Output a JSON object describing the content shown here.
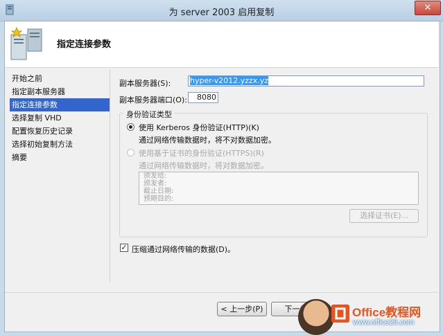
{
  "window": {
    "title": "为 server 2003 启用复制",
    "close_glyph": "✕"
  },
  "header": {
    "title": "指定连接参数"
  },
  "nav": {
    "items": [
      {
        "label": "开始之前",
        "selected": false
      },
      {
        "label": "指定副本服务器",
        "selected": false
      },
      {
        "label": "指定连接参数",
        "selected": true
      },
      {
        "label": "选择复制 VHD",
        "selected": false
      },
      {
        "label": "配置恢复历史记录",
        "selected": false
      },
      {
        "label": "选择初始复制方法",
        "selected": false
      },
      {
        "label": "摘要",
        "selected": false
      }
    ]
  },
  "form": {
    "replica_server_label": "副本服务器(S):",
    "replica_server_value": "hyper-v2012.yzzx.yz",
    "port_label": "副本服务器端口(O):",
    "port_value": "8080",
    "auth_group_title": "身份验证类型",
    "kerberos_label": "使用 Kerberos 身份验证(HTTP)(K)",
    "kerberos_desc": "通过网络传输数据时，将不对数据加密。",
    "cert_label": "使用基于证书的身份验证(HTTPS)(R)",
    "cert_desc": "通过网络传输数据时，将对数据加密。",
    "cert_fields": [
      "颁发给:",
      "颁发者:",
      "截止日期:",
      "预期目的:"
    ],
    "select_cert_button": "选择证书(E)...",
    "compress_label": "压缩通过网络传输的数据(D)。",
    "compress_checked": "✓"
  },
  "footer": {
    "prev_button": "< 上一步(P)",
    "next_button": "下一步"
  },
  "watermark": {
    "brand": "Office教程网",
    "url": "www.office26.com"
  },
  "colors": {
    "nav_selected": "#3366cc",
    "title_bar": "#cfe0ef",
    "close_button": "#c6473a",
    "watermark": "#e8541f"
  },
  "icons": {
    "app": "server-icon",
    "wizard": "replication-server-icon",
    "close": "close-icon"
  }
}
